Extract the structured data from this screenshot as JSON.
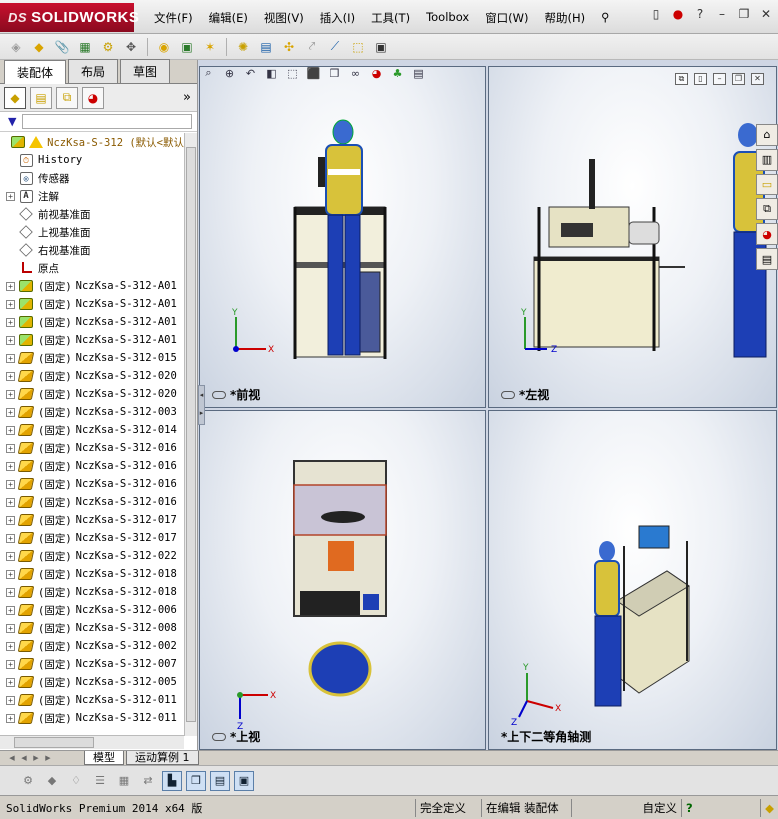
{
  "app": {
    "brand_prefix": "DS",
    "brand": "SOLIDWORKS"
  },
  "menu": [
    "文件(F)",
    "编辑(E)",
    "视图(V)",
    "插入(I)",
    "工具(T)",
    "Toolbox",
    "窗口(W)",
    "帮助(H)"
  ],
  "title_controls": {
    "help": "?",
    "minimize": "–",
    "restore": "❐",
    "close": "✕"
  },
  "command_manager": {
    "tabs": [
      "装配体",
      "布局",
      "草图"
    ],
    "active_tab": 0
  },
  "feature_manager": {
    "more": "»",
    "root_label": "NczKsa-S-312  (默认<默认",
    "items": [
      {
        "type": "history",
        "label": "History"
      },
      {
        "type": "sensor",
        "label": "传感器"
      },
      {
        "type": "annot",
        "label": "注解"
      },
      {
        "type": "plane",
        "label": "前视基准面"
      },
      {
        "type": "plane",
        "label": "上视基准面"
      },
      {
        "type": "plane",
        "label": "右视基准面"
      },
      {
        "type": "origin",
        "label": "原点"
      }
    ],
    "fixed_prefix": "(固定)",
    "components": [
      {
        "kind": "asm",
        "name": "NczKsa-S-312-A01"
      },
      {
        "kind": "asm",
        "name": "NczKsa-S-312-A01"
      },
      {
        "kind": "asm",
        "name": "NczKsa-S-312-A01"
      },
      {
        "kind": "asm",
        "name": "NczKsa-S-312-A01"
      },
      {
        "kind": "part",
        "name": "NczKsa-S-312-015"
      },
      {
        "kind": "part",
        "name": "NczKsa-S-312-020"
      },
      {
        "kind": "part",
        "name": "NczKsa-S-312-020"
      },
      {
        "kind": "part",
        "name": "NczKsa-S-312-003"
      },
      {
        "kind": "part",
        "name": "NczKsa-S-312-014"
      },
      {
        "kind": "part",
        "name": "NczKsa-S-312-016"
      },
      {
        "kind": "part",
        "name": "NczKsa-S-312-016"
      },
      {
        "kind": "part",
        "name": "NczKsa-S-312-016"
      },
      {
        "kind": "part",
        "name": "NczKsa-S-312-016"
      },
      {
        "kind": "part",
        "name": "NczKsa-S-312-017"
      },
      {
        "kind": "part",
        "name": "NczKsa-S-312-017"
      },
      {
        "kind": "part",
        "name": "NczKsa-S-312-022"
      },
      {
        "kind": "part",
        "name": "NczKsa-S-312-018"
      },
      {
        "kind": "part",
        "name": "NczKsa-S-312-018"
      },
      {
        "kind": "part",
        "name": "NczKsa-S-312-006"
      },
      {
        "kind": "part",
        "name": "NczKsa-S-312-008"
      },
      {
        "kind": "part",
        "name": "NczKsa-S-312-002"
      },
      {
        "kind": "part",
        "name": "NczKsa-S-312-007"
      },
      {
        "kind": "part",
        "name": "NczKsa-S-312-005"
      },
      {
        "kind": "part",
        "name": "NczKsa-S-312-011"
      },
      {
        "kind": "part",
        "name": "NczKsa-S-312-011"
      }
    ]
  },
  "viewports": {
    "front": "*前视",
    "left": "*左视",
    "top": "*上视",
    "iso": "*上下二等角轴测"
  },
  "axes": {
    "x": "X",
    "y": "Y",
    "z": "Z"
  },
  "model_tabs": [
    "模型",
    "运动算例 1"
  ],
  "status": {
    "text": "SolidWorks Premium 2014 x64 版",
    "state": "完全定义",
    "editing": "在编辑 装配体",
    "units": "自定义",
    "help": "?"
  },
  "colors": {
    "brand": "#c8102e",
    "viewport_border": "#5a6a80"
  }
}
